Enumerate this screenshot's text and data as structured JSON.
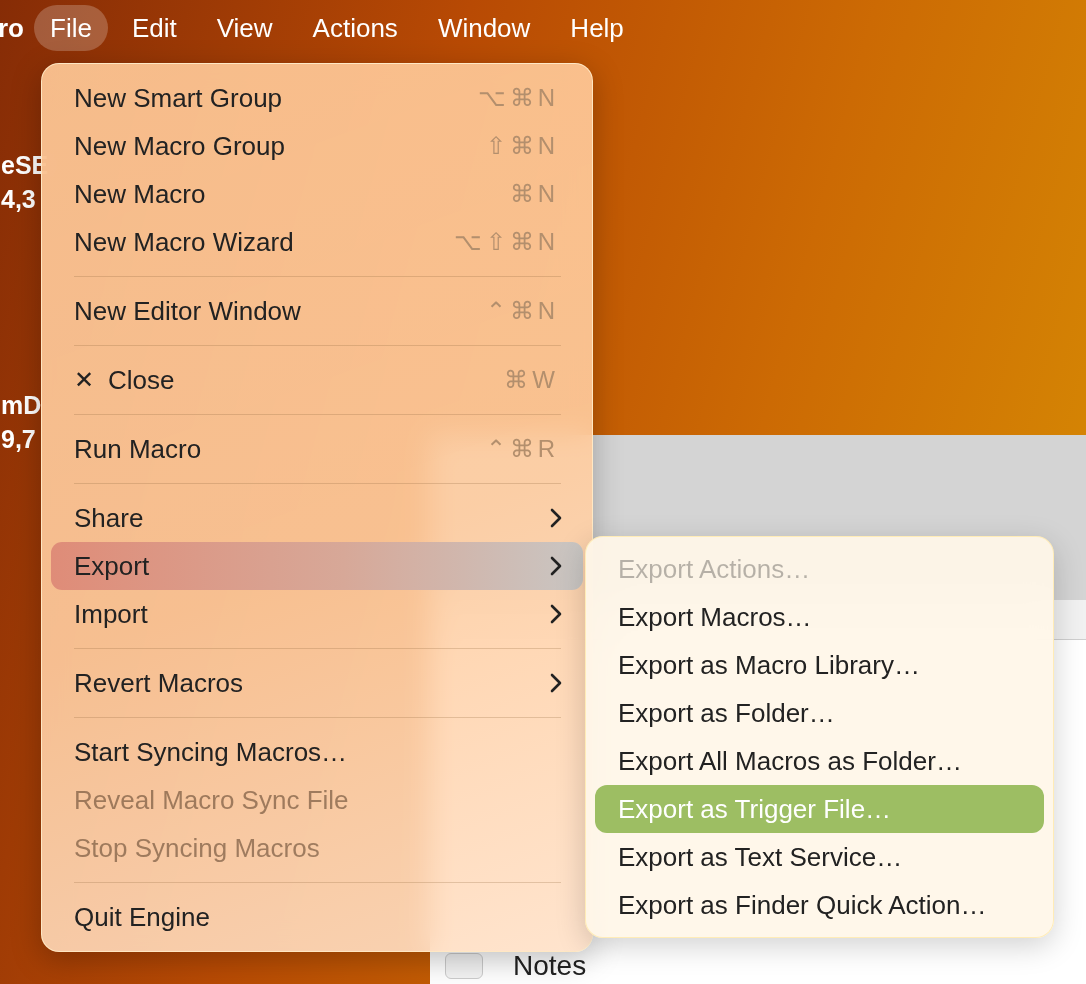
{
  "menubar": {
    "app_name": "ro",
    "items": [
      {
        "label": "File",
        "selected": true
      },
      {
        "label": "Edit",
        "selected": false
      },
      {
        "label": "View",
        "selected": false
      },
      {
        "label": "Actions",
        "selected": false
      },
      {
        "label": "Window",
        "selected": false
      },
      {
        "label": "Help",
        "selected": false
      }
    ]
  },
  "desktop_labels": [
    {
      "title": "eSE",
      "subtitle": "4,3"
    },
    {
      "title": "mD",
      "subtitle": "9,7"
    }
  ],
  "file_menu": [
    {
      "kind": "item",
      "label": "New Smart Group",
      "shortcut": "⌥⌘N",
      "submenu": false,
      "disabled": false,
      "selected": false
    },
    {
      "kind": "item",
      "label": "New Macro Group",
      "shortcut": "⇧⌘N",
      "submenu": false,
      "disabled": false,
      "selected": false
    },
    {
      "kind": "item",
      "label": "New Macro",
      "shortcut": "⌘N",
      "submenu": false,
      "disabled": false,
      "selected": false
    },
    {
      "kind": "item",
      "label": "New Macro Wizard",
      "shortcut": "⌥⇧⌘N",
      "submenu": false,
      "disabled": false,
      "selected": false
    },
    {
      "kind": "separator"
    },
    {
      "kind": "item",
      "label": "New Editor Window",
      "shortcut": "⌃⌘N",
      "submenu": false,
      "disabled": false,
      "selected": false
    },
    {
      "kind": "separator"
    },
    {
      "kind": "item",
      "glyph": "✕",
      "label": "Close",
      "shortcut": "⌘W",
      "submenu": false,
      "disabled": false,
      "selected": false
    },
    {
      "kind": "separator"
    },
    {
      "kind": "item",
      "label": "Run Macro",
      "shortcut": "⌃⌘R",
      "submenu": false,
      "disabled": false,
      "selected": false
    },
    {
      "kind": "separator"
    },
    {
      "kind": "item",
      "label": "Share",
      "submenu": true,
      "disabled": false,
      "selected": false
    },
    {
      "kind": "item",
      "label": "Export",
      "submenu": true,
      "disabled": false,
      "selected": true
    },
    {
      "kind": "item",
      "label": "Import",
      "submenu": true,
      "disabled": false,
      "selected": false
    },
    {
      "kind": "separator"
    },
    {
      "kind": "item",
      "label": "Revert Macros",
      "submenu": true,
      "disabled": false,
      "selected": false
    },
    {
      "kind": "separator"
    },
    {
      "kind": "item",
      "label": "Start Syncing Macros…",
      "submenu": false,
      "disabled": false,
      "selected": false
    },
    {
      "kind": "item",
      "label": "Reveal Macro Sync File",
      "submenu": false,
      "disabled": true,
      "selected": false
    },
    {
      "kind": "item",
      "label": "Stop Syncing Macros",
      "submenu": false,
      "disabled": true,
      "selected": false
    },
    {
      "kind": "separator"
    },
    {
      "kind": "item",
      "label": "Quit Engine",
      "submenu": false,
      "disabled": false,
      "selected": false
    }
  ],
  "export_submenu": [
    {
      "label": "Export Actions…",
      "disabled": true,
      "selected": false
    },
    {
      "label": "Export Macros…",
      "disabled": false,
      "selected": false
    },
    {
      "label": "Export as Macro Library…",
      "disabled": false,
      "selected": false
    },
    {
      "label": "Export as Folder…",
      "disabled": false,
      "selected": false
    },
    {
      "label": "Export All Macros as Folder…",
      "disabled": false,
      "selected": false
    },
    {
      "label": "Export as Trigger File…",
      "disabled": false,
      "selected": true
    },
    {
      "label": "Export as Text Service…",
      "disabled": false,
      "selected": false
    },
    {
      "label": "Export as Finder Quick Action…",
      "disabled": false,
      "selected": false
    }
  ],
  "window": {
    "list": [
      {
        "label": "Notes"
      }
    ]
  }
}
